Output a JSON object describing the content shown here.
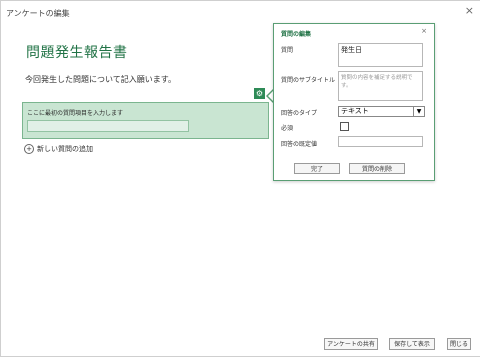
{
  "window": {
    "title": "アンケートの編集",
    "close_glyph": "×"
  },
  "survey": {
    "title": "問題発生報告書",
    "description": "今回発生した問題について記入願います。"
  },
  "question_card": {
    "question_text": "ここに最初の質問項目を入力します",
    "settings_glyph": "⚙"
  },
  "add_question": {
    "label": "新しい質問の追加",
    "icon": "+"
  },
  "edit_panel": {
    "title": "質問の編集",
    "close_glyph": "×",
    "question_label": "質問",
    "question_value": "発生日",
    "subtitle_label": "質問のサブタイトル",
    "subtitle_placeholder": "質問の内容を補足する説明です。",
    "type_label": "回答のタイプ",
    "type_value": "テキスト",
    "type_arrow": "▼",
    "required_label": "必須",
    "default_label": "回答の既定値",
    "done_button": "完了",
    "delete_button": "質問の削除"
  },
  "footer": {
    "share_button": "アンケートの共有",
    "save_view_button": "保存して表示",
    "close_button": "閉じる"
  },
  "colors": {
    "accent": "#217346",
    "card_bg": "#c9e5d2"
  }
}
